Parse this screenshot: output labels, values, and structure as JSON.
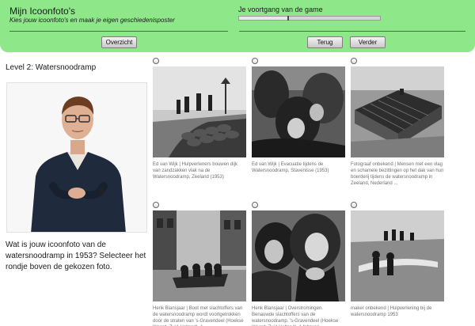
{
  "header": {
    "title": "Mijn Icoonfoto's",
    "subtitle": "Kies jouw icoonfoto's en maak je eigen geschiedenisposter",
    "progress_label": "Je voortgang van de game",
    "progress": 0.35,
    "buttons": {
      "overzicht": "Overzicht",
      "terug": "Terug",
      "verder": "Verder"
    }
  },
  "level": {
    "title": "Level 2: Watersnoodramp"
  },
  "question": "Wat is jouw icoonfoto van de watersnoodramp in 1953? Selecteer het rondje boven de gekozen foto.",
  "photos": [
    {
      "caption": "Ed van Wijk | Hulpverleners bouwen dijk van zandzakken vlak na de Watersnoodramp, Zeeland (1953)"
    },
    {
      "caption": "Ed van Wijk | Evacuatie tijdens de Watersnoodramp, Stavenisse (1953)"
    },
    {
      "caption": "Fotograaf onbekend | Mensen met een vlag en schamele bezittingen op het dak van hun boerderij tijdens de watersnoodramp in Zeeland, Nederland ..."
    },
    {
      "caption": "Henk Blansjaar | Boot met slachtoffers van de watersnoodramp wordt voortgetrokken door de straten van 's-Gravendeel (Hoekse Waard, Zuid-Holland), 1..."
    },
    {
      "caption": "Henk Blansjaar | Overstromingen. Benauwde slachtoffers van de watersnoodramp. 's-Gravendeel (Hoekse Waard, Zuid Holland), 1 februari..."
    },
    {
      "caption": "maker onbekend | Hulpverlening bij de watersnoodramp 1953"
    }
  ]
}
